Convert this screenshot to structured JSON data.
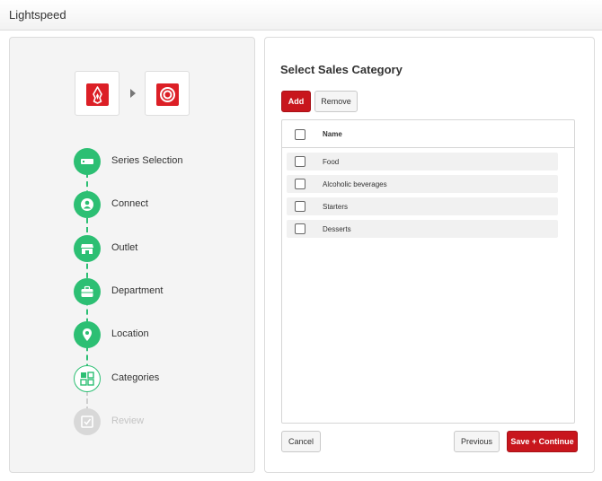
{
  "app": {
    "title": "Lightspeed"
  },
  "integration": {
    "source_icon": "lightspeed-flame-logo-icon",
    "arrow_icon": "chevron-right-icon",
    "target_icon": "ring-logo-icon",
    "brand_color": "#dc1f26"
  },
  "steps": [
    {
      "label": "Series Selection",
      "status": "done",
      "icon": "server-icon"
    },
    {
      "label": "Connect",
      "status": "done",
      "icon": "user-icon"
    },
    {
      "label": "Outlet",
      "status": "done",
      "icon": "store-icon"
    },
    {
      "label": "Department",
      "status": "done",
      "icon": "briefcase-icon"
    },
    {
      "label": "Location",
      "status": "done",
      "icon": "map-pin-icon"
    },
    {
      "label": "Categories",
      "status": "current",
      "icon": "categories-icon"
    },
    {
      "label": "Review",
      "status": "pending",
      "icon": "checkbox-icon"
    }
  ],
  "step_colors": {
    "done": "#2cbf73",
    "pending": "#d8d8d8"
  },
  "main": {
    "title": "Select Sales Category",
    "add_label": "Add",
    "remove_label": "Remove",
    "table": {
      "header": "Name",
      "rows": [
        "Food",
        "Alcoholic beverages",
        "Starters",
        "Desserts"
      ]
    },
    "cancel_label": "Cancel",
    "previous_label": "Previous",
    "save_label": "Save + Continue",
    "accent_color": "#c8161d"
  }
}
